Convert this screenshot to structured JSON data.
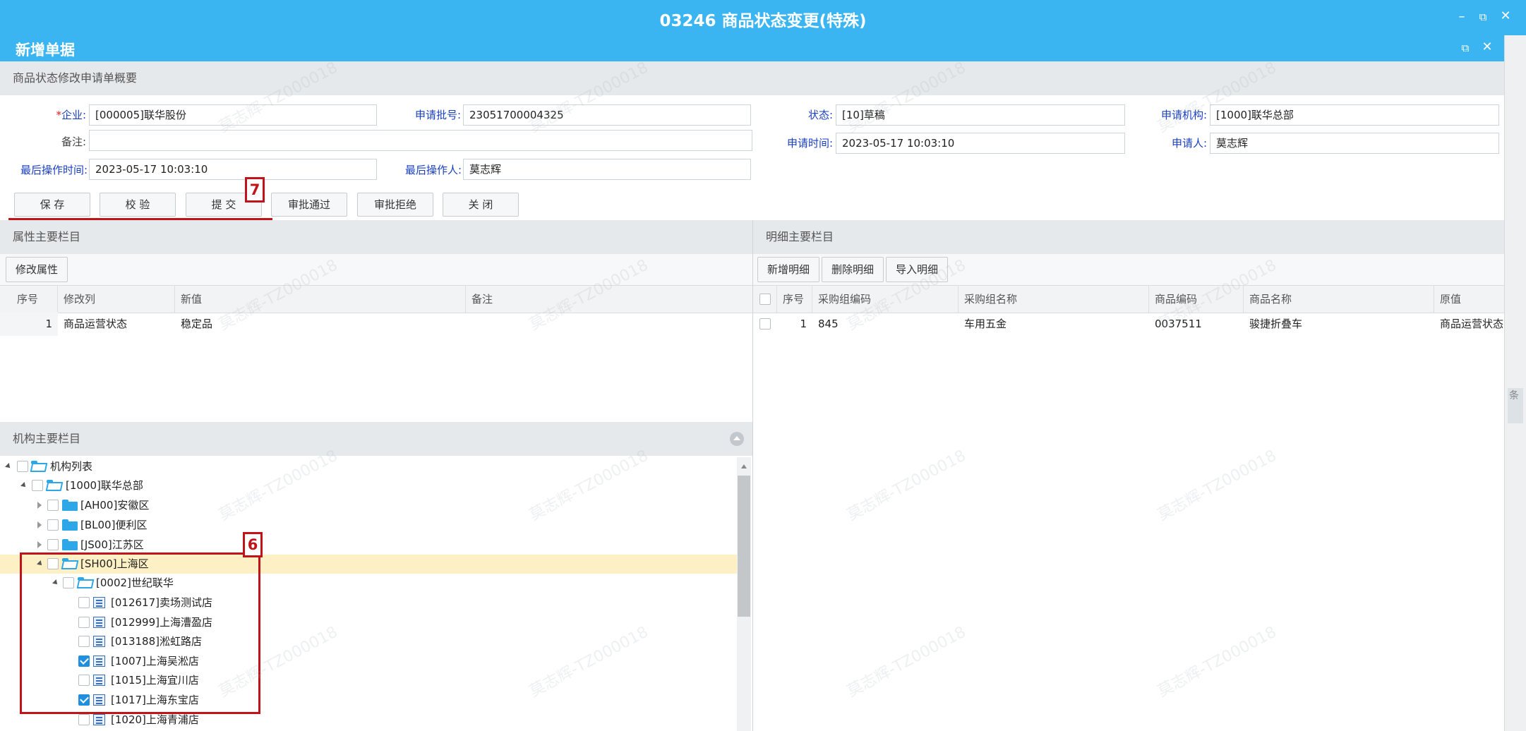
{
  "window": {
    "title": "03246 商品状态变更(特殊)",
    "subtitle": "新增单据"
  },
  "summary": {
    "header": "商品状态修改申请单概要",
    "fields": {
      "company_label": "企业:",
      "company_value": "[000005]联华股份",
      "batch_label": "申请批号:",
      "batch_value": "23051700004325",
      "status_label": "状态:",
      "status_value": "[10]草稿",
      "org_label": "申请机构:",
      "org_value": "[1000]联华总部",
      "remark_label": "备注:",
      "remark_value": "",
      "apply_time_label": "申请时间:",
      "apply_time_value": "2023-05-17 10:03:10",
      "applicant_label": "申请人:",
      "applicant_value": "莫志辉",
      "last_op_time_label": "最后操作时间:",
      "last_op_time_value": "2023-05-17 10:03:10",
      "last_operator_label": "最后操作人:",
      "last_operator_value": "莫志辉"
    },
    "buttons": {
      "save": "保 存",
      "verify": "校 验",
      "submit": "提 交",
      "approve": "审批通过",
      "reject": "审批拒绝",
      "close": "关 闭"
    }
  },
  "attr_panel": {
    "header": "属性主要栏目",
    "modify_button": "修改属性",
    "columns": [
      "序号",
      "修改列",
      "新值",
      "备注"
    ],
    "rows": [
      {
        "no": "1",
        "column": "商品运营状态",
        "new_value": "稳定品",
        "remark": ""
      }
    ]
  },
  "detail_panel": {
    "header": "明细主要栏目",
    "buttons": {
      "add": "新增明细",
      "delete": "删除明细",
      "import": "导入明细"
    },
    "columns": [
      "序号",
      "采购组编码",
      "采购组名称",
      "商品编码",
      "商品名称",
      "原值"
    ],
    "rows": [
      {
        "no": "1",
        "group_code": "845",
        "group_name": "车用五金",
        "item_code": "0037511",
        "item_name": "骏捷折叠车",
        "orig": "商品运营状态:暂停要货"
      }
    ]
  },
  "org_panel": {
    "header": "机构主要栏目",
    "tree": [
      {
        "label": "机构列表",
        "checked": false
      },
      {
        "label": "[1000]联华总部",
        "checked": false
      },
      {
        "label": "[AH00]安徽区",
        "checked": false
      },
      {
        "label": "[BL00]便利区",
        "checked": false
      },
      {
        "label": "[JS00]江苏区",
        "checked": false
      },
      {
        "label": "[SH00]上海区",
        "checked": false
      },
      {
        "label": "[0002]世纪联华",
        "checked": false
      },
      {
        "label": "[012617]卖场测试店",
        "checked": false
      },
      {
        "label": "[012999]上海漕盈店",
        "checked": false
      },
      {
        "label": "[013188]淞虹路店",
        "checked": false
      },
      {
        "label": "[1007]上海吴淞店",
        "checked": true
      },
      {
        "label": "[1015]上海宜川店",
        "checked": false
      },
      {
        "label": "[1017]上海东宝店",
        "checked": true
      },
      {
        "label": "[1020]上海青浦店",
        "checked": false
      }
    ]
  },
  "annotations": {
    "badge_submit": "7",
    "badge_tree": "6"
  },
  "side": {
    "edge_text": "条"
  },
  "watermark": "莫志辉-TZ000018",
  "colors": {
    "titlebar": "#3ab5f2",
    "accent_label": "#1a3fbf",
    "marker": "#c0141a",
    "selected_row": "#fdf0c4"
  }
}
